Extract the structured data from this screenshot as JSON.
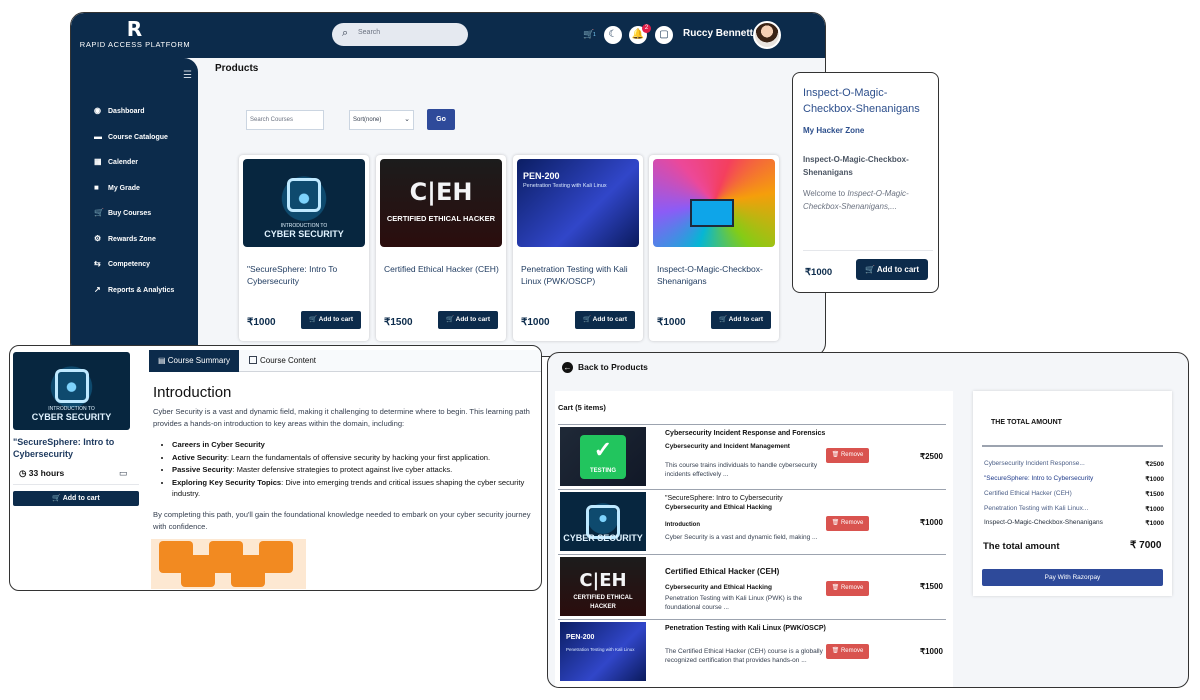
{
  "app": {
    "logo_mark": "R",
    "logo_text": "RAPID ACCESS PLATFORM",
    "search_placeholder": "Search",
    "cart_count": "1",
    "notification_count": "2",
    "user_name": "Ruccy Bennett"
  },
  "sidebar": {
    "items": [
      {
        "label": "Dashboard",
        "icon": "dashboard-icon",
        "glyph": "◉"
      },
      {
        "label": "Course Catalogue",
        "icon": "catalogue-icon",
        "glyph": "▬"
      },
      {
        "label": "Calender",
        "icon": "calendar-icon",
        "glyph": "▦"
      },
      {
        "label": "My Grade",
        "icon": "grade-icon",
        "glyph": "■"
      },
      {
        "label": "Buy Courses",
        "icon": "cart-icon",
        "glyph": "🛒"
      },
      {
        "label": "Rewards Zone",
        "icon": "rewards-icon",
        "glyph": "⚙"
      },
      {
        "label": "Competency",
        "icon": "competency-icon",
        "glyph": "⇆"
      },
      {
        "label": "Reports & Analytics",
        "icon": "chart-icon",
        "glyph": "↗"
      }
    ]
  },
  "products": {
    "page_title": "Products",
    "search_placeholder": "Search Courses",
    "sort_value": "Sort(none)",
    "go_label": "Go",
    "cards": [
      {
        "title": "\"SecureSphere: Intro To Cybersecurity",
        "price": "₹1000",
        "add_label": "Add to cart",
        "thumb_text": "CYBER SECURITY",
        "thumb_sub": "INTRODUCTION TO"
      },
      {
        "title": "Certified Ethical Hacker (CEH)",
        "price": "₹1500",
        "add_label": "Add to cart",
        "thumb_text": "C|EH",
        "thumb_sub": "CERTIFIED ETHICAL HACKER"
      },
      {
        "title": "Penetration Testing with Kali Linux (PWK/OSCP)",
        "price": "₹1000",
        "add_label": "Add to cart",
        "thumb_text": "PEN-200",
        "thumb_sub": "Penetration Testing with Kali Linux"
      },
      {
        "title": "Inspect-O-Magic-Checkbox-Shenanigans",
        "price": "₹1000",
        "add_label": "Add to cart",
        "thumb_text": "",
        "thumb_sub": ""
      }
    ]
  },
  "popup": {
    "title": "Inspect-O-Magic-Checkbox-Shenanigans",
    "zone": "My Hacker Zone",
    "subtitle": "Inspect-O-Magic-Checkbox-Shenanigans",
    "welcome_prefix": "Welcome to ",
    "welcome_italic": "Inspect-O-Magic-Checkbox-Shenanigans,...",
    "price": "₹1000",
    "add_label": "Add to cart"
  },
  "detail": {
    "course_title": "\"SecureSphere: Intro to Cybersecurity",
    "hours": "33 hours",
    "add_label": "Add to cart",
    "tab_summary": "Course Summary",
    "tab_content": "Course Content",
    "heading": "Introduction",
    "intro": "Cyber Security is a vast and dynamic field, making it challenging to determine where to begin. This learning path provides a hands-on introduction to key areas within the domain, including:",
    "bullets": [
      {
        "bold": "Careers in Cyber Security",
        "text": ""
      },
      {
        "bold": "Active Security",
        "text": ": Learn the fundamentals of offensive security by hacking your first application."
      },
      {
        "bold": "Passive Security",
        "text": ": Master defensive strategies to protect against live cyber attacks."
      },
      {
        "bold": "Exploring Key Security Topics",
        "text": ": Dive into emerging trends and critical issues shaping the cyber security industry."
      }
    ],
    "closing": "By completing this path, you'll gain the foundational knowledge needed to embark on your cyber security journey with confidence."
  },
  "cart": {
    "back_label": "Back to Products",
    "title": "Cart (5 items)",
    "remove_label": "Remove",
    "items": [
      {
        "name": "Cybersecurity Incident Response and Forensics",
        "category": "Cybersecurity and Incident Management",
        "desc": "This course trains individuals to handle cybersecurity incidents effectively ...",
        "price": "₹2500"
      },
      {
        "name": "\"SecureSphere: Intro to Cybersecurity",
        "category": "Cybersecurity and Ethical Hacking",
        "extra": "Introduction",
        "desc": "Cyber Security is a vast and dynamic field, making ...",
        "price": "₹1000"
      },
      {
        "name": "Certified Ethical Hacker (CEH)",
        "category": "Cybersecurity and Ethical Hacking",
        "desc": "Penetration Testing with Kali Linux (PWK) is the foundational course ...",
        "price": "₹1500"
      },
      {
        "name": "Penetration Testing with Kali Linux (PWK/OSCP)",
        "category": "",
        "desc": "The Certified Ethical Hacker (CEH) course is a globally recognized certification that provides hands-on ...",
        "price": "₹1000"
      }
    ],
    "summary_title": "THE TOTAL AMOUNT",
    "summary_rows": [
      {
        "label": "Cybersecurity Incident Response...",
        "value": "₹2500"
      },
      {
        "label": "\"SecureSphere: Intro to Cybersecurity",
        "value": "₹1000"
      },
      {
        "label": "Certified Ethical Hacker (CEH)",
        "value": "₹1500"
      },
      {
        "label": "Penetration Testing with Kali Linux...",
        "value": "₹1000"
      },
      {
        "label": "Inspect-O-Magic-Checkbox-Shenanigans",
        "value": "₹1000"
      }
    ],
    "total_label": "The total amount",
    "total_value": "₹ 7000",
    "pay_label": "Pay With Razorpay",
    "testing_label": "TESTING"
  }
}
